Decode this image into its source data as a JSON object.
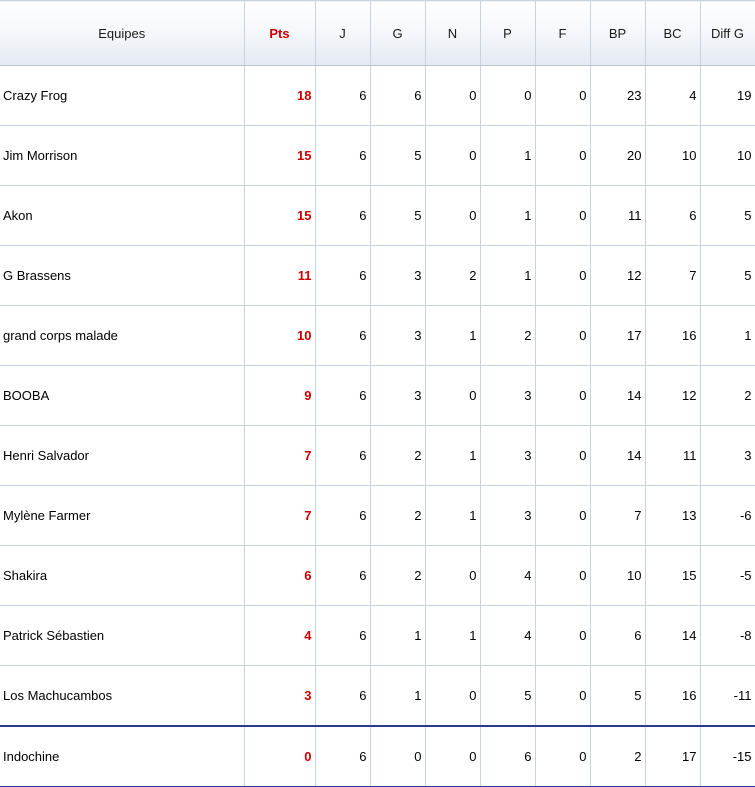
{
  "table": {
    "columns": [
      "Equipes",
      "Pts",
      "J",
      "G",
      "N",
      "P",
      "F",
      "BP",
      "BC",
      "Diff G"
    ],
    "rows": [
      {
        "team": "Crazy Frog",
        "pts": "18",
        "j": "6",
        "g": "6",
        "n": "0",
        "p": "0",
        "f": "0",
        "bp": "23",
        "bc": "4",
        "diff": "19"
      },
      {
        "team": "Jim Morrison",
        "pts": "15",
        "j": "6",
        "g": "5",
        "n": "0",
        "p": "1",
        "f": "0",
        "bp": "20",
        "bc": "10",
        "diff": "10"
      },
      {
        "team": "Akon",
        "pts": "15",
        "j": "6",
        "g": "5",
        "n": "0",
        "p": "1",
        "f": "0",
        "bp": "11",
        "bc": "6",
        "diff": "5"
      },
      {
        "team": "G Brassens",
        "pts": "11",
        "j": "6",
        "g": "3",
        "n": "2",
        "p": "1",
        "f": "0",
        "bp": "12",
        "bc": "7",
        "diff": "5"
      },
      {
        "team": "grand corps malade",
        "pts": "10",
        "j": "6",
        "g": "3",
        "n": "1",
        "p": "2",
        "f": "0",
        "bp": "17",
        "bc": "16",
        "diff": "1"
      },
      {
        "team": "BOOBA",
        "pts": "9",
        "j": "6",
        "g": "3",
        "n": "0",
        "p": "3",
        "f": "0",
        "bp": "14",
        "bc": "12",
        "diff": "2"
      },
      {
        "team": "Henri Salvador",
        "pts": "7",
        "j": "6",
        "g": "2",
        "n": "1",
        "p": "3",
        "f": "0",
        "bp": "14",
        "bc": "11",
        "diff": "3"
      },
      {
        "team": "Mylène Farmer",
        "pts": "7",
        "j": "6",
        "g": "2",
        "n": "1",
        "p": "3",
        "f": "0",
        "bp": "7",
        "bc": "13",
        "diff": "-6"
      },
      {
        "team": "Shakira",
        "pts": "6",
        "j": "6",
        "g": "2",
        "n": "0",
        "p": "4",
        "f": "0",
        "bp": "10",
        "bc": "15",
        "diff": "-5"
      },
      {
        "team": "Patrick Sébastien",
        "pts": "4",
        "j": "6",
        "g": "1",
        "n": "1",
        "p": "4",
        "f": "0",
        "bp": "6",
        "bc": "14",
        "diff": "-8"
      },
      {
        "team": "Los Machucambos",
        "pts": "3",
        "j": "6",
        "g": "1",
        "n": "0",
        "p": "5",
        "f": "0",
        "bp": "5",
        "bc": "16",
        "diff": "-11"
      },
      {
        "team": "Indochine",
        "pts": "0",
        "j": "6",
        "g": "0",
        "n": "0",
        "p": "6",
        "f": "0",
        "bp": "2",
        "bc": "17",
        "diff": "-15"
      }
    ]
  },
  "colors": {
    "points_red": "#cc0000",
    "grid_line": "#c9d3df",
    "relegation_line": "#2b3a8f"
  }
}
